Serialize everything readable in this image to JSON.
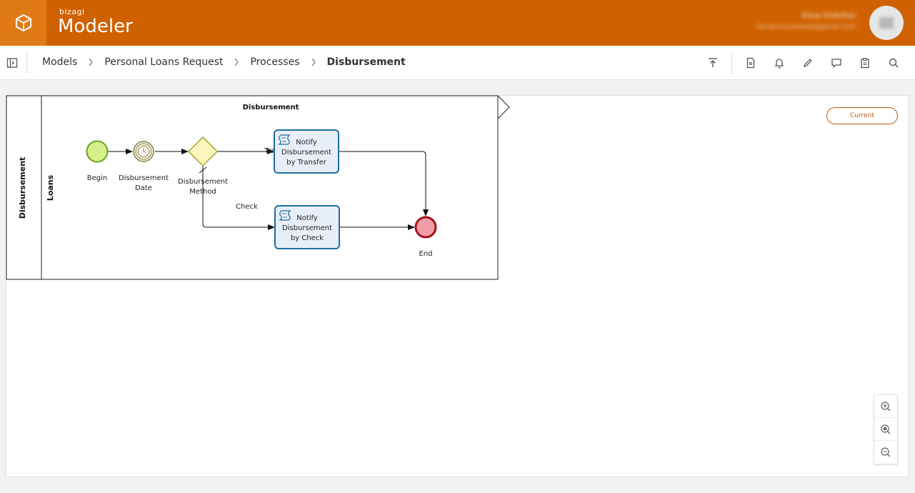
{
  "app": {
    "brand_small": "bizagi",
    "brand_name": "Modeler",
    "user_name": "Elisa Ordoñez",
    "user_email": "bpmprocessmodel@gmail.com"
  },
  "breadcrumb": [
    "Models",
    "Personal Loans Request",
    "Processes",
    "Disbursement"
  ],
  "toolbar": {
    "icons": [
      "publish-icon",
      "document-icon",
      "notifications-icon",
      "edit-icon",
      "comments-icon",
      "clipboard-icon",
      "search-icon"
    ]
  },
  "diagram": {
    "pool_name": "Disbursement",
    "lane_name": "Loans",
    "title": "Disbursement",
    "version_badge": "Current",
    "elements": {
      "begin": "Begin",
      "timer_line1": "Disbursement",
      "timer_line2": "Date",
      "gateway_line1": "Disbursement",
      "gateway_line2": "Method",
      "task1_line1": "Notify",
      "task1_line2": "Disbursement",
      "task1_line3": "by Transfer",
      "task2_line1": "Notify",
      "task2_line2": "Disbursement",
      "task2_line3": "by Check",
      "end": "End"
    },
    "flow_labels": {
      "transfer": "Transfer",
      "check": "Check"
    }
  },
  "zoom": {
    "icons": [
      "zoom-in-icon",
      "zoom-reset-icon",
      "zoom-out-icon"
    ]
  },
  "colors": {
    "header": "#cf6100",
    "logo_box": "#e07a17",
    "start_event": "#d7f08a",
    "end_event": "#ee9ea4",
    "task_fill": "#e8eef8",
    "task_border": "#1d6da3",
    "gateway_fill": "#fbf7bf"
  }
}
